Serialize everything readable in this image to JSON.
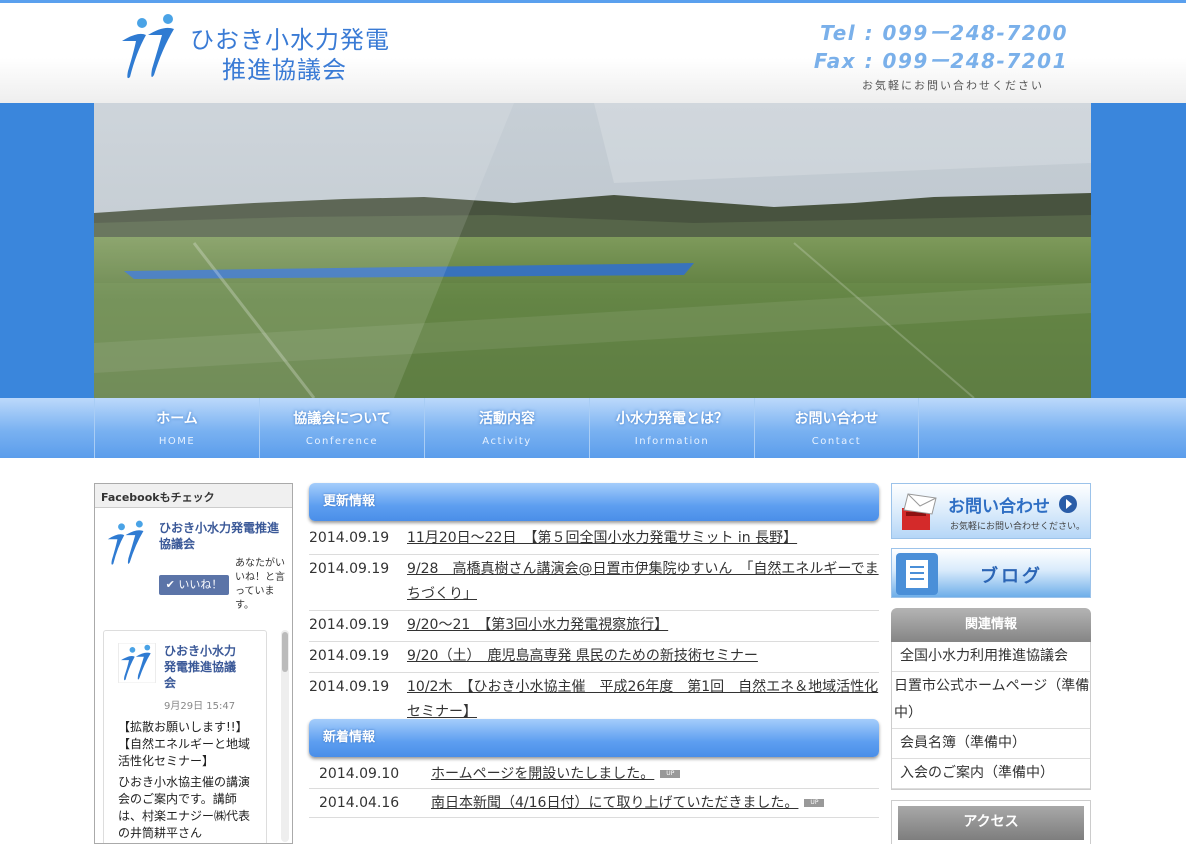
{
  "header": {
    "logo_line1": "ひおき小水力発電",
    "logo_line2": "推進協議会",
    "tel": "Tel : 099ー248-7200",
    "fax": "Fax : 099ー248-7201",
    "contact_note": "お気軽にお問い合わせください"
  },
  "nav": [
    {
      "jp": "ホーム",
      "en": "HOME"
    },
    {
      "jp": "協議会について",
      "en": "Conference"
    },
    {
      "jp": "活動内容",
      "en": "Activity"
    },
    {
      "jp": "小水力発電とは？",
      "en": "Information"
    },
    {
      "jp": "お問い合わせ",
      "en": "Contact"
    }
  ],
  "facebook": {
    "header": "Facebookもチェック",
    "page_name": "ひおき小水力発電推進協議会",
    "like_label": "✔ いいね！",
    "friends_text": "あなたがいいね！と言っています。",
    "post": {
      "name": "ひおき小水力発電推進協議会",
      "date": "9月29日 15:47",
      "body1": "【拡散お願いします!!】【自然エネルギーと地域活性化セミナー】",
      "body2": "ひおき小水協主催の講演会のご案内です。講師は、村楽エナジー㈱代表の井筒耕平さん"
    }
  },
  "updates": {
    "title": "更新情報",
    "items": [
      {
        "date": "2014.09.19",
        "title": "11月20日～22日　【第５回全国小水力発電サミット in 長野】"
      },
      {
        "date": "2014.09.19",
        "title": "9/28　高橋真樹さん講演会@日置市伊集院ゆすいん　「自然エネルギーでまちづくり」"
      },
      {
        "date": "2014.09.19",
        "title": "9/20～21　【第3回小水力発電視察旅行】"
      },
      {
        "date": "2014.09.19",
        "title": "9/20（土）　鹿児島高専発 県民のための新技術セミナー"
      },
      {
        "date": "2014.09.19",
        "title": "10/2木　【ひおき小水協主催　平成26年度　第1回　自然エネ＆地域活性化セミナー】"
      }
    ]
  },
  "newinfo": {
    "title": "新着情報",
    "badge": "UP",
    "items": [
      {
        "date": "2014.09.10",
        "title": "ホームページを開設いたしました。"
      },
      {
        "date": "2014.04.16",
        "title": "南日本新聞（4/16日付）にて取り上げていただきました。"
      }
    ]
  },
  "sidebar": {
    "contact_title": "お問い合わせ",
    "contact_sub": "お気軽にお問い合わせください。",
    "blog_title": "ブログ",
    "related_title": "関連情報",
    "related": [
      "全国小水力利用推進協議会",
      "日置市公式ホームページ（準備中）",
      "会員名簿（準備中）",
      "入会のご案内（準備中）"
    ],
    "access_title": "アクセス"
  },
  "colors": {
    "accent_blue": "#3a86dc",
    "logo_blue": "#3a7bd5",
    "phone_blue": "#7ab0ea"
  }
}
